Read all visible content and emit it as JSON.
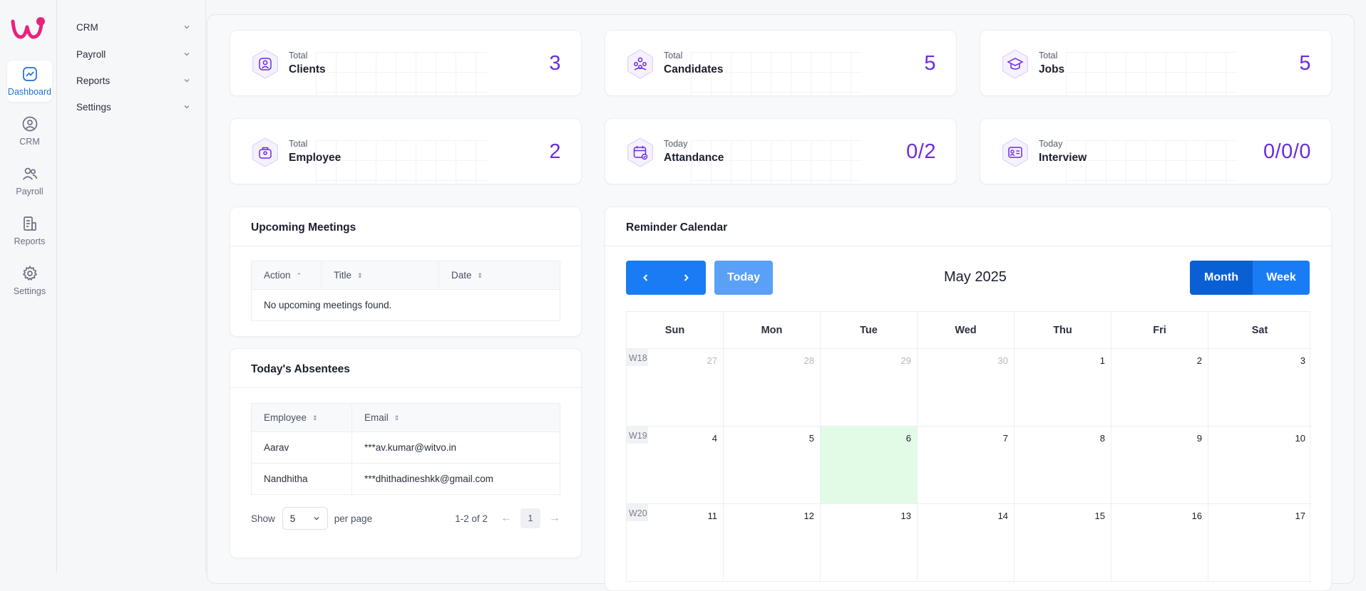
{
  "rail": {
    "items": [
      {
        "label": "Dashboard",
        "icon": "chart-icon",
        "active": true
      },
      {
        "label": "CRM",
        "icon": "user-circle-icon",
        "active": false
      },
      {
        "label": "Payroll",
        "icon": "users-icon",
        "active": false
      },
      {
        "label": "Reports",
        "icon": "report-icon",
        "active": false
      },
      {
        "label": "Settings",
        "icon": "gear-icon",
        "active": false
      }
    ]
  },
  "submenu": {
    "items": [
      {
        "label": "CRM"
      },
      {
        "label": "Payroll"
      },
      {
        "label": "Reports"
      },
      {
        "label": "Settings"
      }
    ]
  },
  "stats": [
    {
      "small": "Total",
      "label": "Clients",
      "value": "3",
      "icon": "client-icon"
    },
    {
      "small": "Total",
      "label": "Candidates",
      "value": "5",
      "icon": "candidates-icon"
    },
    {
      "small": "Total",
      "label": "Jobs",
      "value": "5",
      "icon": "graduation-cap-icon"
    },
    {
      "small": "Total",
      "label": "Employee",
      "value": "2",
      "icon": "employee-icon"
    },
    {
      "small": "Today",
      "label": "Attandance",
      "value": "0/2",
      "icon": "calendar-check-icon"
    },
    {
      "small": "Today",
      "label": "Interview",
      "value": "0/0/0",
      "icon": "id-card-icon"
    }
  ],
  "meetings": {
    "title": "Upcoming Meetings",
    "columns": [
      "Action",
      "Title",
      "Date"
    ],
    "empty": "No upcoming meetings found."
  },
  "absentees": {
    "title": "Today's Absentees",
    "columns": [
      "Employee",
      "Email"
    ],
    "rows": [
      [
        "Aarav",
        "***av.kumar@witvo.in"
      ],
      [
        "Nandhitha",
        "***dhithadineshkk@gmail.com"
      ]
    ],
    "show_label": "Show",
    "per_page_value": "5",
    "per_page_label": "per page",
    "range": "1-2 of 2",
    "page": "1"
  },
  "calendar": {
    "title": "Reminder Calendar",
    "today_label": "Today",
    "month_title": "May 2025",
    "view_month": "Month",
    "view_week": "Week",
    "days": [
      "Sun",
      "Mon",
      "Tue",
      "Wed",
      "Thu",
      "Fri",
      "Sat"
    ],
    "weeks": [
      {
        "label": "W18",
        "dates": [
          "27",
          "28",
          "29",
          "30",
          "1",
          "2",
          "3"
        ],
        "muted": [
          true,
          true,
          true,
          true,
          false,
          false,
          false
        ]
      },
      {
        "label": "W19",
        "dates": [
          "4",
          "5",
          "6",
          "7",
          "8",
          "9",
          "10"
        ],
        "muted": [
          false,
          false,
          false,
          false,
          false,
          false,
          false
        ]
      },
      {
        "label": "W20",
        "dates": [
          "11",
          "12",
          "13",
          "14",
          "15",
          "16",
          "17"
        ],
        "muted": [
          false,
          false,
          false,
          false,
          false,
          false,
          false
        ]
      }
    ],
    "highlight": "6"
  },
  "colors": {
    "accent": "#6c2be0",
    "primary": "#1a7cf4",
    "primary_dark": "#0a5fd4",
    "today_btn": "#5aa0f7",
    "highlight": "#e1fbe6",
    "logo": "#e8237c"
  }
}
